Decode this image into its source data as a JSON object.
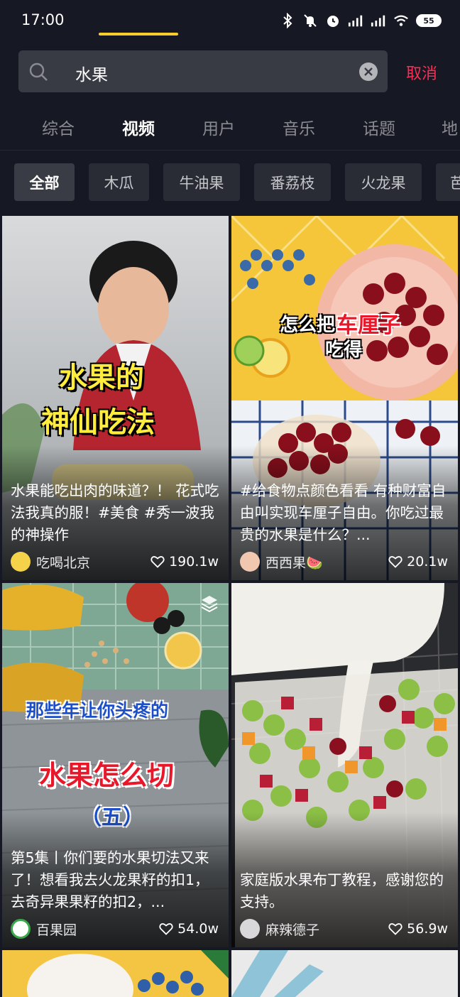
{
  "status_bar": {
    "time": "17:00",
    "battery": "55",
    "icons": [
      "bluetooth-icon",
      "mute-icon",
      "alarm-icon",
      "signal-icon",
      "signal-icon",
      "wifi-icon",
      "battery-icon"
    ]
  },
  "search": {
    "query": "水果",
    "cancel_label": "取消"
  },
  "tabs": [
    {
      "label": "综合",
      "active": false
    },
    {
      "label": "视频",
      "active": true
    },
    {
      "label": "用户",
      "active": false
    },
    {
      "label": "音乐",
      "active": false
    },
    {
      "label": "话题",
      "active": false
    },
    {
      "label": "地",
      "active": false
    }
  ],
  "chips": [
    {
      "label": "全部",
      "active": true
    },
    {
      "label": "木瓜",
      "active": false
    },
    {
      "label": "牛油果",
      "active": false
    },
    {
      "label": "番荔枝",
      "active": false
    },
    {
      "label": "火龙果",
      "active": false
    },
    {
      "label": "芭",
      "active": false
    }
  ],
  "videos": [
    {
      "overlay_lines": [
        "水果的",
        "神仙吃法"
      ],
      "description": "水果能吃出肉的味道？！ 花式吃法我真的服！#美食 #秀一波我的神操作",
      "author": "吃喝北京",
      "likes": "190.1w"
    },
    {
      "overlay_lines": [
        "怎么把",
        "车厘子",
        "吃得"
      ],
      "description": "#给食物点颜色看看 有种财富自由叫实现车厘子自由。你吃过最贵的水果是什么？...",
      "author": "西西果🍉",
      "likes": "20.1w"
    },
    {
      "overlay_lines": [
        "那些年让你头疼的",
        "水果怎么切",
        "（五）"
      ],
      "description": "第5集丨你们要的水果切法又来了！想看我去火龙果籽的扣1，去奇异果果籽的扣2，...",
      "author": "百果园",
      "likes": "54.0w"
    },
    {
      "overlay_lines": [],
      "description": "家庭版水果布丁教程，感谢您的支持。",
      "author": "麻辣德子",
      "likes": "56.9w"
    }
  ],
  "colors": {
    "background": "#161823",
    "accent_underline": "#facd2f",
    "cancel": "#fe2c55"
  }
}
